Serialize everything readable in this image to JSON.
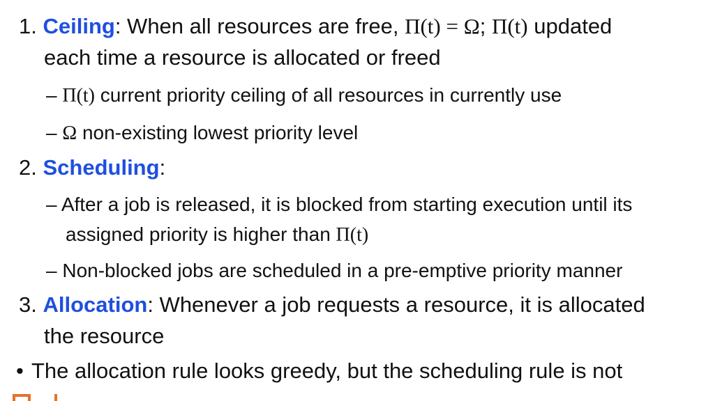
{
  "items": [
    {
      "number": "1.",
      "keyword": "Ceiling",
      "line1_text": ": When all resources are free, ",
      "line1_math_a": "Π(t) = Ω",
      "line1_sep": "; ",
      "line1_math_b": "Π(t)",
      "line1_tail": " updated",
      "line2_text": "each time a resource is allocated or freed",
      "subs": [
        {
          "dash": "–",
          "math": "Π(t)",
          "text": " current priority ceiling of all resources in currently use"
        },
        {
          "dash": "–",
          "math": "Ω",
          "text": " non-existing lowest priority level"
        }
      ]
    },
    {
      "number": "2.",
      "keyword": "Scheduling",
      "line1_text": ":",
      "subs": [
        {
          "dash": "–",
          "text": "After a job is released, it is blocked from starting execution until its",
          "cont_text": "assigned priority is higher than ",
          "cont_math": "Π(t)"
        },
        {
          "dash": "–",
          "text": "Non-blocked jobs are scheduled in a pre-emptive priority manner"
        }
      ]
    },
    {
      "number": "3.",
      "keyword": "Allocation",
      "line1_text": ": Whenever a job requests a resource, it is allocated",
      "line2_text": "the resource"
    }
  ],
  "footer_bullet": {
    "symbol": "•",
    "text": "The allocation rule looks greedy, but the scheduling rule is not"
  },
  "colors": {
    "keyword": "#1f4fe0",
    "logo": "#e8702a"
  }
}
